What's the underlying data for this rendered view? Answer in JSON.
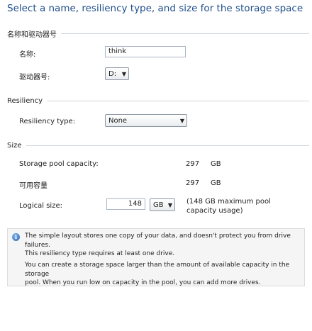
{
  "title": "Select a name, resiliency type, and size for the storage space",
  "name_group": {
    "header": "名称和驱动器号",
    "name_label": "名称:",
    "name_value": "think",
    "drive_label": "驱动器号:",
    "drive_value": "D:"
  },
  "resiliency_group": {
    "header": "Resiliency",
    "type_label": "Resiliency type:",
    "type_value": "None"
  },
  "size_group": {
    "header": "Size",
    "pool_capacity_label": "Storage pool capacity:",
    "pool_capacity_value": "297",
    "pool_capacity_unit": "GB",
    "available_label": "可用容量",
    "available_value": "297",
    "available_unit": "GB",
    "logical_size_label": "Logical size:",
    "logical_size_value": "148",
    "logical_size_unit": "GB",
    "max_pool_note_line1": "(148 GB maximum pool",
    "max_pool_note_line2": "capacity usage)"
  },
  "info": {
    "icon": "info-icon",
    "para1_line1": "The simple layout stores one copy of your data, and doesn't protect you from drive failures.",
    "para1_line2": "This resiliency type requires at least one drive.",
    "para2_line1": "You can create a storage space larger than the amount of available capacity in the storage",
    "para2_line2": "pool. When you run low on capacity in the pool, you can add more drives."
  },
  "colors": {
    "title": "#1f4f8c",
    "divider": "#cfd6de",
    "info_background": "#f5f5f5"
  }
}
